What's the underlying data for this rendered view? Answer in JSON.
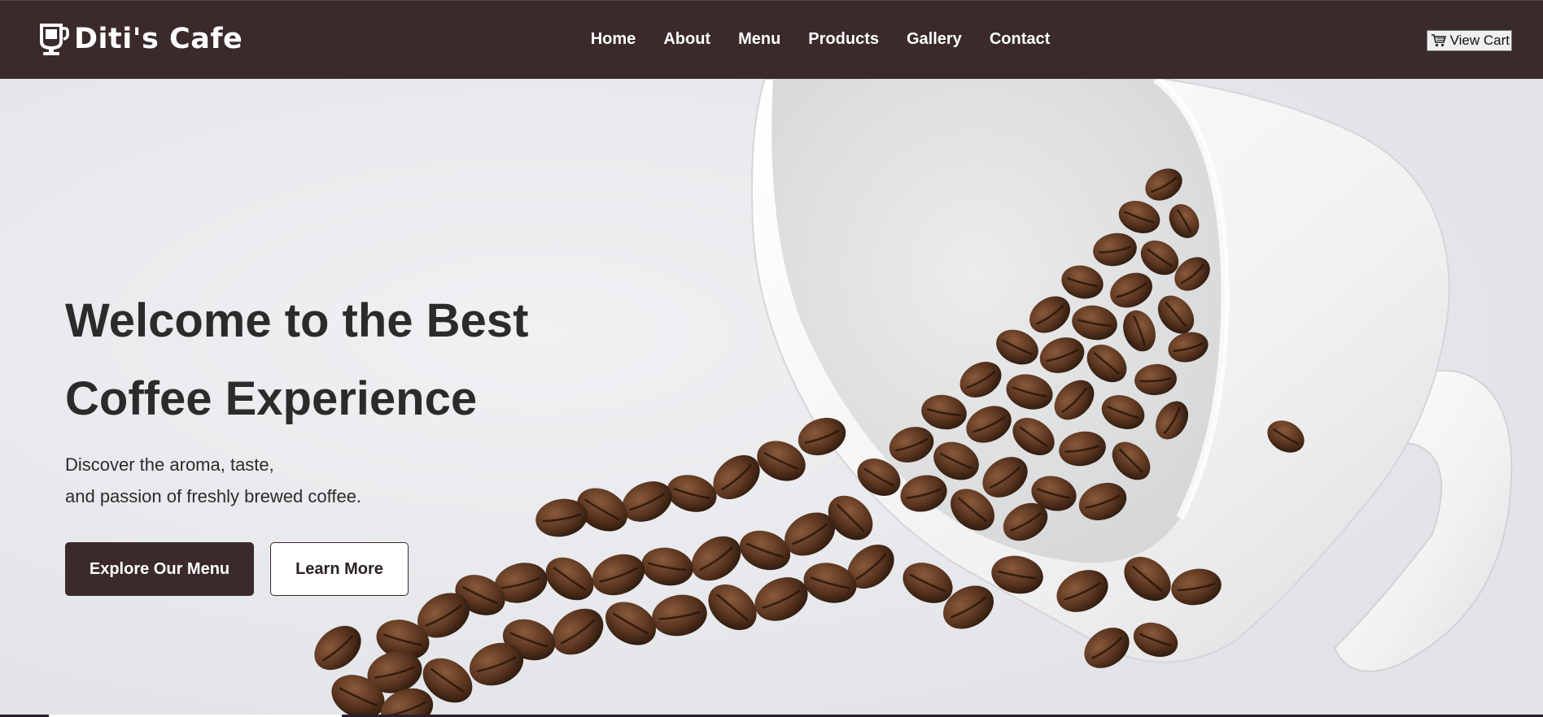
{
  "brand": {
    "name": "Diti's Cafe",
    "icon": "coffee-cup-icon"
  },
  "nav": {
    "items": [
      {
        "label": "Home"
      },
      {
        "label": "About"
      },
      {
        "label": "Menu"
      },
      {
        "label": "Products"
      },
      {
        "label": "Gallery"
      },
      {
        "label": "Contact"
      }
    ],
    "cart_label": "View Cart",
    "cart_icon": "shopping-cart-icon"
  },
  "hero": {
    "title_line1": "Welcome to the Best",
    "title_line2": "Coffee Experience",
    "subtitle_line1": "Discover the aroma, taste,",
    "subtitle_line2": "and passion of freshly brewed coffee.",
    "primary_button": "Explore Our Menu",
    "secondary_button": "Learn More",
    "image": "coffee-beans-spilling-from-white-cup"
  },
  "colors": {
    "navbar": "#3b2a2b",
    "primary_button": "#3b2a2b",
    "text": "#2b2b2b",
    "bean": "#5a3520"
  }
}
